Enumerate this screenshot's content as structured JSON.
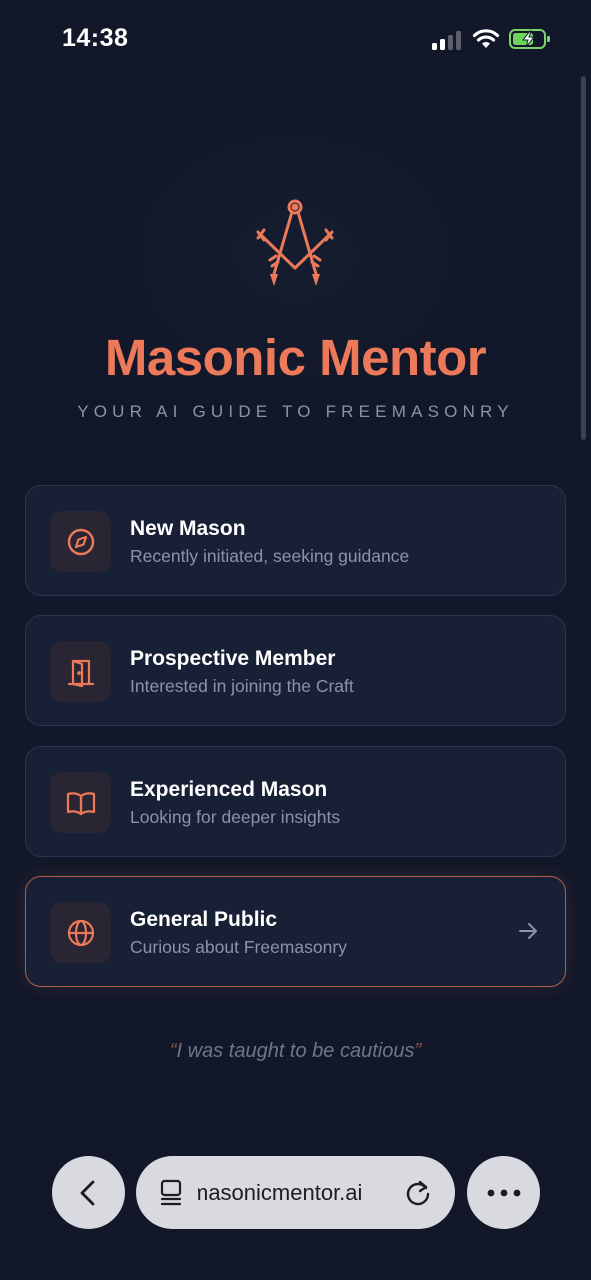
{
  "status_bar": {
    "time": "14:38"
  },
  "hero": {
    "title": "Masonic Mentor",
    "subtitle": "YOUR AI GUIDE TO FREEMASONRY",
    "logo_icon": "compass-and-keys-icon"
  },
  "options": [
    {
      "label": "New Mason",
      "description": "Recently initiated, seeking guidance",
      "icon": "compass-icon",
      "selected": false
    },
    {
      "label": "Prospective Member",
      "description": "Interested in joining the Craft",
      "icon": "door-icon",
      "selected": false
    },
    {
      "label": "Experienced Mason",
      "description": "Looking for deeper insights",
      "icon": "open-book-icon",
      "selected": false
    },
    {
      "label": "General Public",
      "description": "Curious about Freemasonry",
      "icon": "globe-icon",
      "selected": true
    }
  ],
  "quote": {
    "open_mark": "“",
    "text": "I was taught to be cautious",
    "close_mark": "”"
  },
  "browser": {
    "url": "masonicmentor.ai"
  },
  "colors": {
    "background": "#121829",
    "accent": "#ec7a5a",
    "card": "#182036",
    "muted_text": "#8a93a8"
  }
}
